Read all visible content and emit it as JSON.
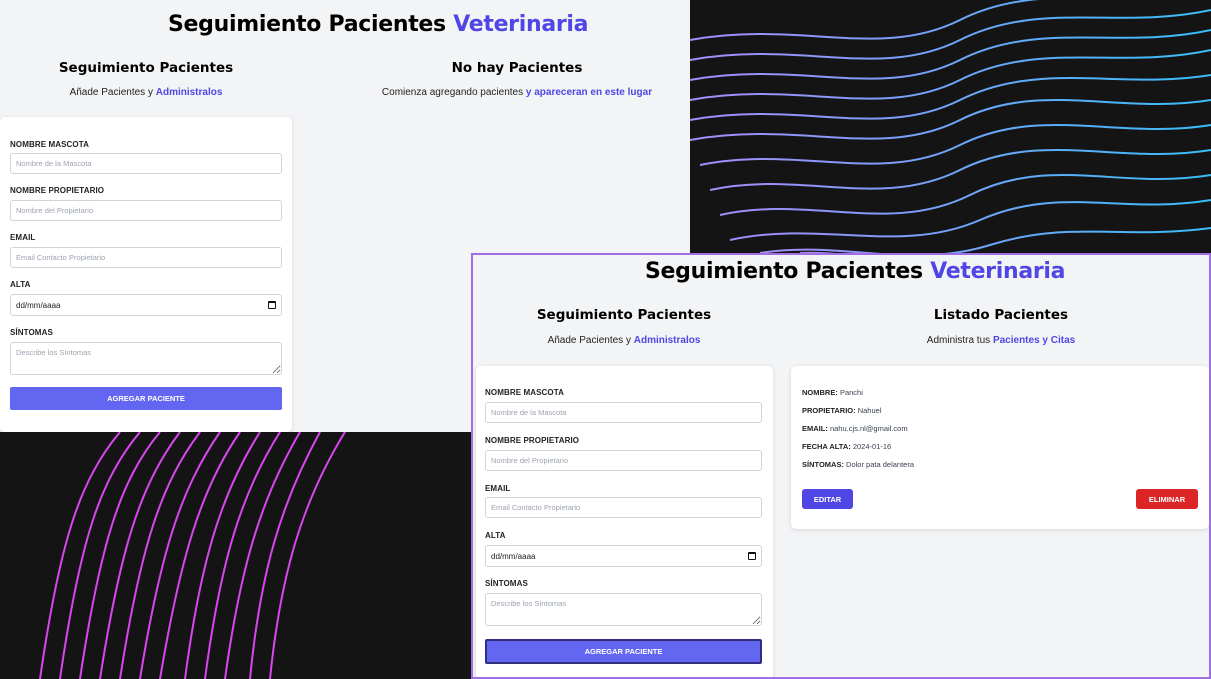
{
  "colors": {
    "accent": "#4f46e5",
    "button": "#6366f1",
    "danger": "#dc2626",
    "frame": "#a06ee0"
  },
  "header": {
    "title_main": "Seguimiento Pacientes",
    "title_accent": "Veterinaria"
  },
  "form_section": {
    "title": "Seguimiento Pacientes",
    "subtitle_plain": "Añade Pacientes y",
    "subtitle_accent": "Administralos"
  },
  "form": {
    "pet_label": "NOMBRE MASCOTA",
    "pet_placeholder": "Nombre de la Mascota",
    "owner_label": "NOMBRE PROPIETARIO",
    "owner_placeholder": "Nombre del Propietario",
    "email_label": "EMAIL",
    "email_placeholder": "Email Contacto Propietario",
    "date_label": "ALTA",
    "date_value": "dd/mm/aaaa",
    "symptoms_label": "SÍNTOMAS",
    "symptoms_placeholder": "Describe los Síntomas",
    "submit_label": "AGREGAR PACIENTE"
  },
  "empty_section": {
    "title": "No hay Pacientes",
    "subtitle_plain": "Comienza agregando pacientes",
    "subtitle_accent": "y apareceran en este lugar"
  },
  "list_section": {
    "title": "Listado Pacientes",
    "subtitle_plain": "Administra tus",
    "subtitle_accent": "Pacientes y Citas"
  },
  "patients": [
    {
      "name_label": "NOMBRE:",
      "name": "Panchi",
      "owner_label": "PROPIETARIO:",
      "owner": "Nahuel",
      "email_label": "EMAIL:",
      "email": "nahu.cjs.nl@gmail.com",
      "date_label": "FECHA ALTA:",
      "date": "2024-01-16",
      "symptoms_label": "SÍNTOMAS:",
      "symptoms": "Dolor pata delantera",
      "edit_label": "EDITAR",
      "delete_label": "ELIMINAR"
    }
  ]
}
